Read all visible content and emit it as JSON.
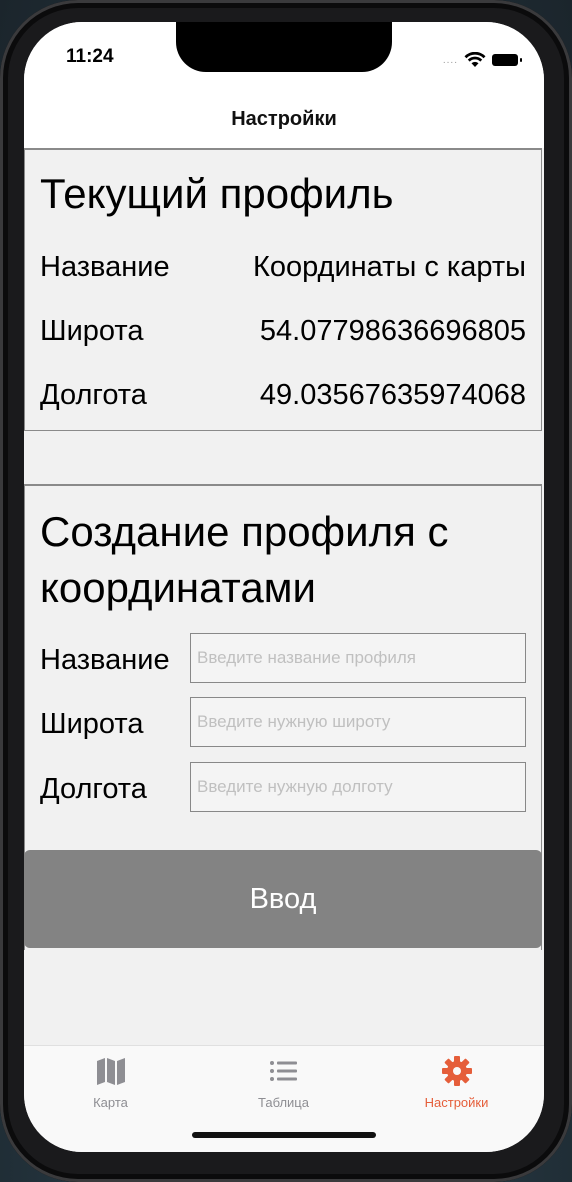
{
  "status_bar": {
    "time": "11:24",
    "signal": "....",
    "icons": [
      "wifi-icon",
      "battery-icon"
    ]
  },
  "navbar": {
    "title": "Настройки"
  },
  "current_profile": {
    "title": "Текущий профиль",
    "rows": [
      {
        "label": "Название",
        "value": "Координаты с карты"
      },
      {
        "label": "Широта",
        "value": "54.07798636696805"
      },
      {
        "label": "Долгота",
        "value": "49.03567635974068"
      }
    ]
  },
  "create_profile": {
    "title_line1": "Создание профиля с",
    "title_line2": "координатами",
    "fields": [
      {
        "label": "Название",
        "value": "",
        "placeholder": "Введите название профиля"
      },
      {
        "label": "Широта",
        "value": "",
        "placeholder": "Введите нужную широту"
      },
      {
        "label": "Долгота",
        "value": "",
        "placeholder": "Введите нужную долготу"
      }
    ],
    "submit_label": "Ввод"
  },
  "tabbar": {
    "tabs": [
      {
        "label": "Карта",
        "icon": "map-icon",
        "active": false
      },
      {
        "label": "Таблица",
        "icon": "list-icon",
        "active": false
      },
      {
        "label": "Настройки",
        "icon": "gear-icon",
        "active": true
      }
    ]
  },
  "colors": {
    "accent": "#e55e3a",
    "button_bg": "#838383",
    "panel_border": "#8a8a8a",
    "inactive_tab": "#8e8e93"
  }
}
